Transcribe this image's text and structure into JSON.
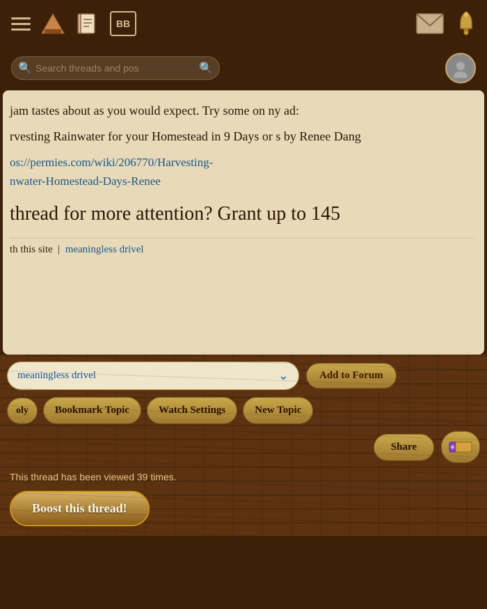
{
  "nav": {
    "hamburger_label": "menu",
    "bb_label": "BB",
    "search_placeholder": "Search threads and pos",
    "avatar_label": "user avatar"
  },
  "content": {
    "text1": "jam tastes about as you would expect. Try some on ny ad:",
    "text2": "rvesting Rainwater for your Homestead in 9 Days or s by Renee Dang",
    "link_text": "os://permies.com/wiki/206770/Harvesting-\nnwater-Homestead-Days-Renee",
    "attention_text": "thread for more attention? Grant up to 145",
    "footer_site": "th this site",
    "footer_divider": "|",
    "footer_drivel": "meaningless drivel"
  },
  "toolbar": {
    "dropdown_value": "meaningless drivel",
    "dropdown_placeholder": "meaningless drivel",
    "add_forum_label": "Add to Forum",
    "bookmark_label": "Bookmark Topic",
    "watch_label": "Watch Settings",
    "new_topic_label": "New Topic",
    "reply_label": "oly",
    "share_label": "Share",
    "boost_label": "Boost this thread!",
    "view_count": "This thread has been viewed 39 times."
  }
}
